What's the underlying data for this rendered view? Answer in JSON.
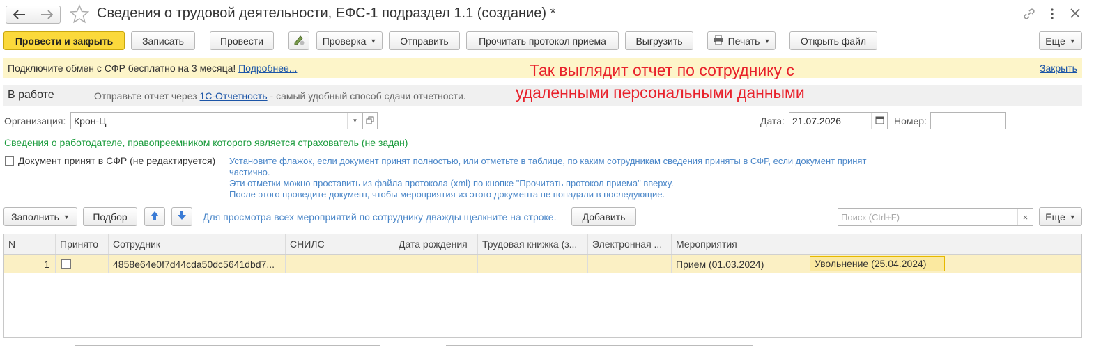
{
  "window": {
    "title": "Сведения о трудовой деятельности, ЕФС-1 подраздел 1.1 (создание) *"
  },
  "toolbar": {
    "post_close": "Провести и закрыть",
    "save": "Записать",
    "post": "Провести",
    "check": "Проверка",
    "send": "Отправить",
    "read_protocol": "Прочитать протокол приема",
    "export": "Выгрузить",
    "print": "Печать",
    "open_file": "Открыть файл",
    "more": "Еще"
  },
  "banner": {
    "text": "Подключите обмен с СФР бесплатно на 3 месяца!",
    "more_link": "Подробнее...",
    "close_link": "Закрыть"
  },
  "annotation": {
    "line1": "Так выглядит отчет по сотруднику с",
    "line2": "удаленными персональными данными"
  },
  "status": {
    "state_link": "В работе",
    "hint_prefix": "Отправьте отчет через",
    "hint_link": "1С-Отчетность",
    "hint_suffix": "- самый удобный способ сдачи отчетности."
  },
  "form": {
    "org_label": "Организация:",
    "org_value": "Крон-Ц",
    "date_label": "Дата:",
    "date_value": "21.07.2026",
    "number_label": "Номер:",
    "number_value": "",
    "employer_link": "Сведения о работодателе, правопреемником которого является страхователь (не задан)",
    "accepted_label": "Документ принят в СФР (не редактируется)",
    "info_lines": [
      "Установите флажок, если документ принят полностью, или отметьте в таблице, по каким сотрудникам сведения приняты в СФР, если документ принят",
      "частично.",
      "Эти отметки можно проставить из файла протокола (xml) по кнопке \"Прочитать протокол приема\" вверху.",
      "После этого проведите документ, чтобы мероприятия из этого документа не попадали в последующие."
    ]
  },
  "table_toolbar": {
    "fill": "Заполнить",
    "select": "Подбор",
    "hint": "Для просмотра всех мероприятий по сотруднику дважды щелкните на строке.",
    "add": "Добавить",
    "search_placeholder": "Поиск (Ctrl+F)",
    "more": "Еще"
  },
  "table": {
    "columns": [
      "N",
      "Принято",
      "Сотрудник",
      "СНИЛС",
      "Дата рождения",
      "Трудовая книжка (з...",
      "Электронная ...",
      "Мероприятия"
    ],
    "rows": [
      {
        "n": "1",
        "accepted": false,
        "employee": "4858e64e0f7d44cda50dc5641dbd7...",
        "snils": "",
        "birth_date": "",
        "work_book": "",
        "electronic": "",
        "event1": "Прием (01.03.2024)",
        "event2": "Увольнение (25.04.2024)"
      }
    ]
  },
  "colors": {
    "primary_button": "#fbd93b",
    "banner_bg": "#fdf5c9",
    "annotation_red": "#e8212b",
    "link_blue": "#1c55a7",
    "employer_link_green": "#1a9b3c",
    "row_highlight": "#fbf0c4"
  }
}
